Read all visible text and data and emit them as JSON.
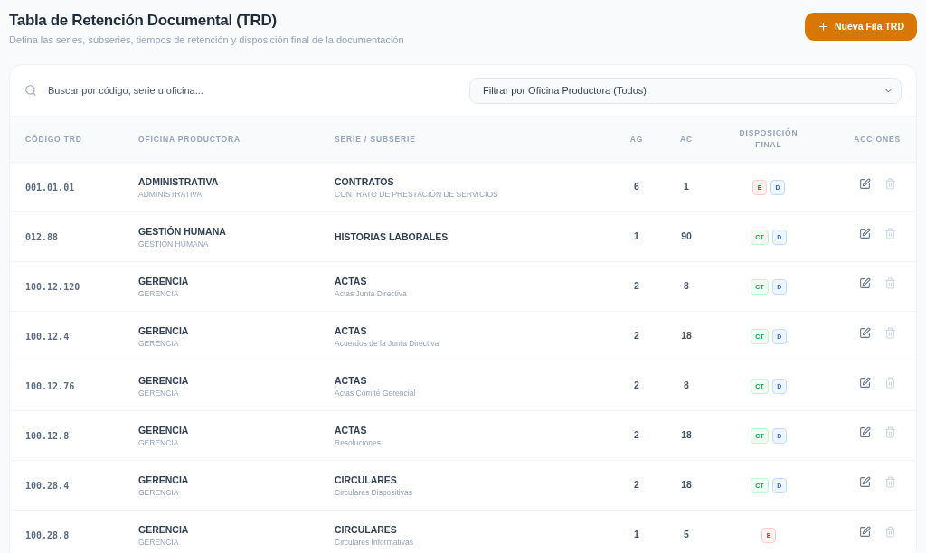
{
  "header": {
    "title": "Tabla de Retención Documental (TRD)",
    "subtitle": "Defina las series, subseries, tiempos de retención y disposición final de la documentación",
    "new_button": {
      "label": "Nueva Fila TRD"
    }
  },
  "search": {
    "placeholder": "Buscar por código, serie u oficina..."
  },
  "office_filter": {
    "value": "Filtrar por Oficina Productora (Todos)"
  },
  "table": {
    "columns": [
      "CÓDIGO TRD",
      "OFICINA PRODUCTORA",
      "SERIE / SUBSERIE",
      "AG",
      "AC",
      "DISPOSICIÓN FINAL",
      "ACCIONES"
    ],
    "rows": [
      {
        "code": "001.01.01",
        "office": "ADMINISTRATIVA",
        "office_sub": "ADMINISTRATIVA",
        "series": "CONTRATOS",
        "subseries": "CONTRATO DE PRESTACIÓN DE SERVICIOS",
        "ag": "6",
        "ac": "1",
        "disposition": [
          {
            "label": "E",
            "kind": "danger"
          },
          {
            "label": "D",
            "kind": "info"
          }
        ]
      },
      {
        "code": "012.88",
        "office": "GESTIÓN HUMANA",
        "office_sub": "GESTIÓN HUMANA",
        "series": "HISTORIAS LABORALES",
        "ag": "1",
        "ac": "90",
        "disposition": [
          {
            "label": "CT",
            "kind": "success"
          },
          {
            "label": "D",
            "kind": "info"
          }
        ]
      },
      {
        "code": "100.12.120",
        "office": "GERENCIA",
        "office_sub": "GERENCIA",
        "series": "ACTAS",
        "subseries": "Actas Junta Directiva",
        "ag": "2",
        "ac": "8",
        "disposition": [
          {
            "label": "CT",
            "kind": "success"
          },
          {
            "label": "D",
            "kind": "info"
          }
        ]
      },
      {
        "code": "100.12.4",
        "office": "GERENCIA",
        "office_sub": "GERENCIA",
        "series": "ACTAS",
        "subseries": "Acuerdos de la Junta Directiva",
        "ag": "2",
        "ac": "18",
        "disposition": [
          {
            "label": "CT",
            "kind": "success"
          },
          {
            "label": "D",
            "kind": "info"
          }
        ]
      },
      {
        "code": "100.12.76",
        "office": "GERENCIA",
        "office_sub": "GERENCIA",
        "series": "ACTAS",
        "subseries": "Actas Comité Gerencial",
        "ag": "2",
        "ac": "8",
        "disposition": [
          {
            "label": "CT",
            "kind": "success"
          },
          {
            "label": "D",
            "kind": "info"
          }
        ]
      },
      {
        "code": "100.12.8",
        "office": "GERENCIA",
        "office_sub": "GERENCIA",
        "series": "ACTAS",
        "subseries": "Resoluciones",
        "ag": "2",
        "ac": "18",
        "disposition": [
          {
            "label": "CT",
            "kind": "success"
          },
          {
            "label": "D",
            "kind": "info"
          }
        ]
      },
      {
        "code": "100.28.4",
        "office": "GERENCIA",
        "office_sub": "GERENCIA",
        "series": "CIRCULARES",
        "subseries": "Circulares Dispositivas",
        "ag": "2",
        "ac": "18",
        "disposition": [
          {
            "label": "CT",
            "kind": "success"
          },
          {
            "label": "D",
            "kind": "info"
          }
        ]
      },
      {
        "code": "100.28.8",
        "office": "GERENCIA",
        "office_sub": "GERENCIA",
        "series": "CIRCULARES",
        "subseries": "Circulares Informativas",
        "ag": "1",
        "ac": "5",
        "disposition": [
          {
            "label": "E",
            "kind": "danger"
          }
        ]
      }
    ]
  }
}
